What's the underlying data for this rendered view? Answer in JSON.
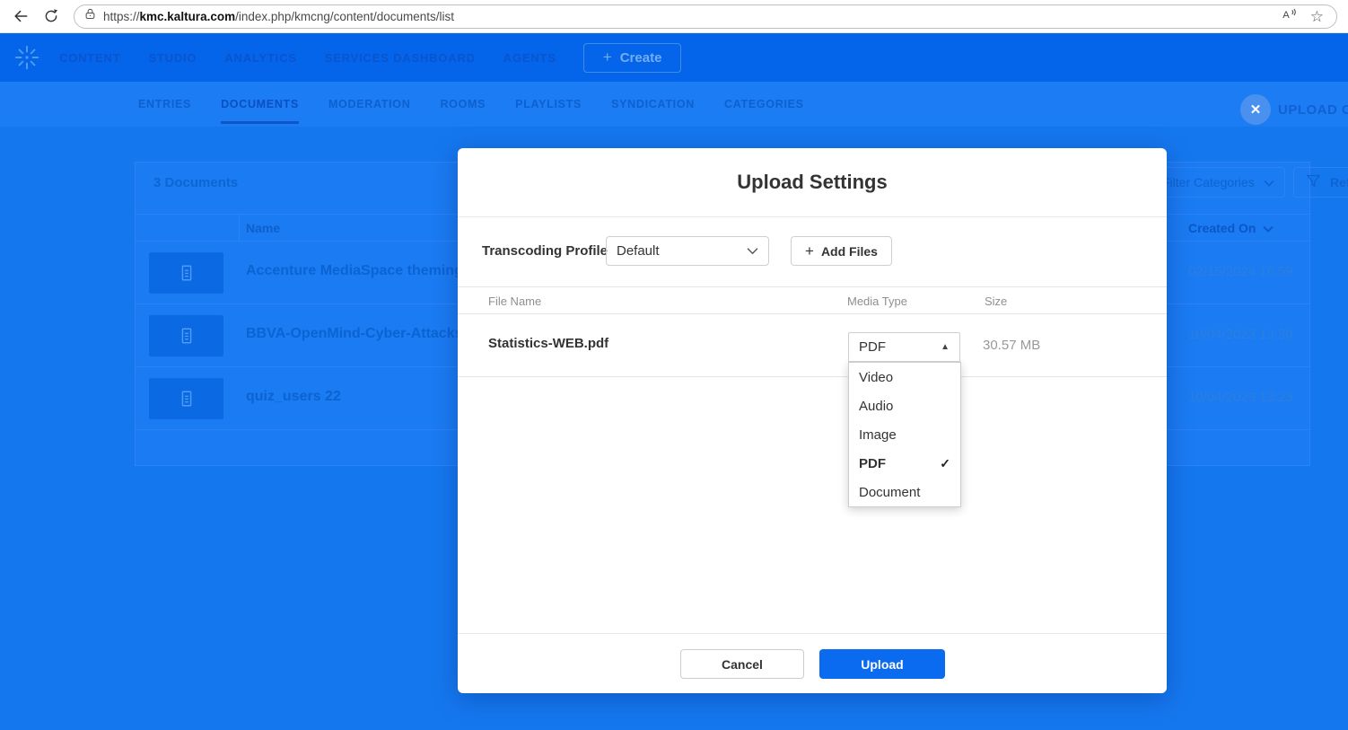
{
  "browser": {
    "url_scheme": "https://",
    "url_domain": "kmc.kaltura.com",
    "url_path": "/index.php/kmcng/content/documents/list"
  },
  "topnav": {
    "items": [
      "CONTENT",
      "STUDIO",
      "ANALYTICS",
      "SERVICES DASHBOARD",
      "AGENTS"
    ],
    "create_label": "Create",
    "create_plus": "+"
  },
  "subnav": {
    "items": [
      "ENTRIES",
      "DOCUMENTS",
      "MODERATION",
      "ROOMS",
      "PLAYLISTS",
      "SYNDICATION",
      "CATEGORIES"
    ],
    "active_item": "DOCUMENTS"
  },
  "background": {
    "count_label": "3 Documents",
    "filter_categories_label": "Filter Categories",
    "refine_label": "Refine",
    "table": {
      "name_header": "Name",
      "created_header": "Created On",
      "rows": [
        {
          "name": "Accenture MediaSpace theming",
          "created": "02/15/2024 16:59"
        },
        {
          "name": "BBVA-OpenMind-Cyber-Attacks-M",
          "created": "10/04/2023 13:30"
        },
        {
          "name": "quiz_users 22",
          "created": "10/04/2023 13:23"
        }
      ]
    }
  },
  "upload_control": {
    "label": "UPLOAD CONTROL",
    "close_glyph": "✕"
  },
  "modal": {
    "title": "Upload Settings",
    "transcoding_label": "Transcoding Profile",
    "transcoding_value": "Default",
    "add_files_label": "Add Files",
    "add_files_plus": "+",
    "columns": {
      "file": "File Name",
      "type": "Media Type",
      "size": "Size"
    },
    "file": {
      "name": "Statistics-WEB.pdf",
      "type": "PDF",
      "size": "30.57 MB"
    },
    "dropdown": {
      "options": [
        "Video",
        "Audio",
        "Image",
        "PDF",
        "Document"
      ],
      "selected": "PDF",
      "check_glyph": "✓",
      "caret_up_glyph": "▲"
    },
    "cancel_label": "Cancel",
    "upload_label": "Upload"
  },
  "colors": {
    "kaltura_blue": "#0b6cf5",
    "overlay_background": "#1577ee",
    "upload_button": "#0a6af0",
    "close_circle": "#4a90ee",
    "link_blue": "#0c63d2"
  }
}
